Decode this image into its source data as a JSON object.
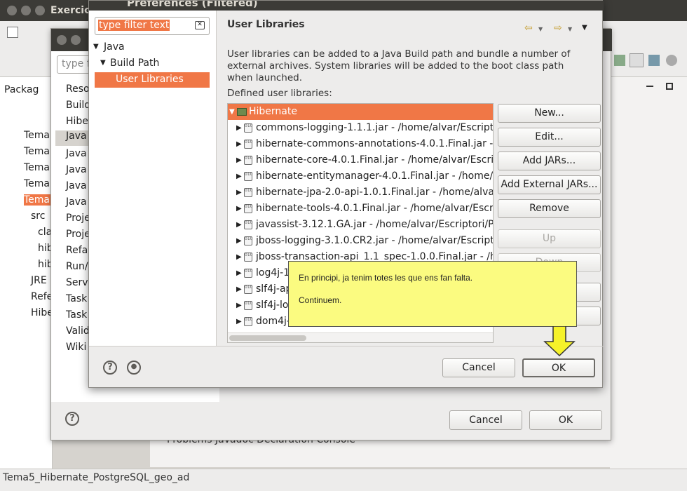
{
  "workbench": {
    "window_title": "Exercici",
    "status_text": "Tema5_Hibernate_PostgreSQL_geo_ad",
    "package_explorer_title": "Packag",
    "tree_items": [
      "Tema",
      "Tema",
      "Tema",
      "Tema",
      "Tema",
      "src",
      "cla",
      "hib",
      "hib",
      "JRE",
      "Refe",
      "Hibe"
    ],
    "console_tabs": "Problems  Javadoc  Declaration  Console"
  },
  "mid_dialog": {
    "filter_placeholder": "type f",
    "nav_items": [
      "Reso",
      "Build",
      "Hibe",
      "Java",
      "Java",
      "Java",
      "Java",
      "Java",
      "Proje",
      "Proje",
      "Refa",
      "Run/",
      "Serve",
      "Task",
      "Task",
      "Valid",
      "Wiki"
    ],
    "cancel_label": "Cancel",
    "ok_label": "OK"
  },
  "dialog": {
    "title": "Preferences (Filtered)",
    "filter_text": "type filter text",
    "nav": {
      "java": "Java",
      "build_path": "Build Path",
      "user_libraries": "User Libraries"
    },
    "page_title": "User Libraries",
    "description": "User libraries can be added to a Java Build path and bundle a number of external archives. System libraries will be added to the boot class path when launched.",
    "defined_label": "Defined user libraries:",
    "library": "Hibernate",
    "jars": [
      "commons-logging-1.1.1.jar - /home/alvar/Escripto",
      "hibernate-commons-annotations-4.0.1.Final.jar - /",
      "hibernate-core-4.0.1.Final.jar - /home/alvar/Escrip",
      "hibernate-entitymanager-4.0.1.Final.jar - /home/a",
      "hibernate-jpa-2.0-api-1.0.1.Final.jar - /home/alvar",
      "hibernate-tools-4.0.1.Final.jar - /home/alvar/Escr",
      "javassist-3.12.1.GA.jar - /home/alvar/Escriptori/P",
      "jboss-logging-3.1.0.CR2.jar - /home/alvar/Escripto",
      "jboss-transaction-api_1.1_spec-1.0.0.Final.jar - /h",
      "log4j-1.",
      "slf4j-ap",
      "slf4j-lo",
      "dom4j-"
    ],
    "buttons": {
      "new": "New...",
      "edit": "Edit...",
      "add_jars": "Add JARs...",
      "add_external_jars": "Add External JARs...",
      "remove": "Remove",
      "up": "Up",
      "down": "Down"
    },
    "cancel_label": "Cancel",
    "ok_label": "OK",
    "help_icon": "?"
  },
  "tooltip": {
    "line1": "En principi, ja tenim totes les que ens fan falta.",
    "line2": "Continuem."
  },
  "colors": {
    "selection": "#f07746",
    "tooltip_bg": "#fbfb80",
    "arrow": "#f6f22a"
  }
}
